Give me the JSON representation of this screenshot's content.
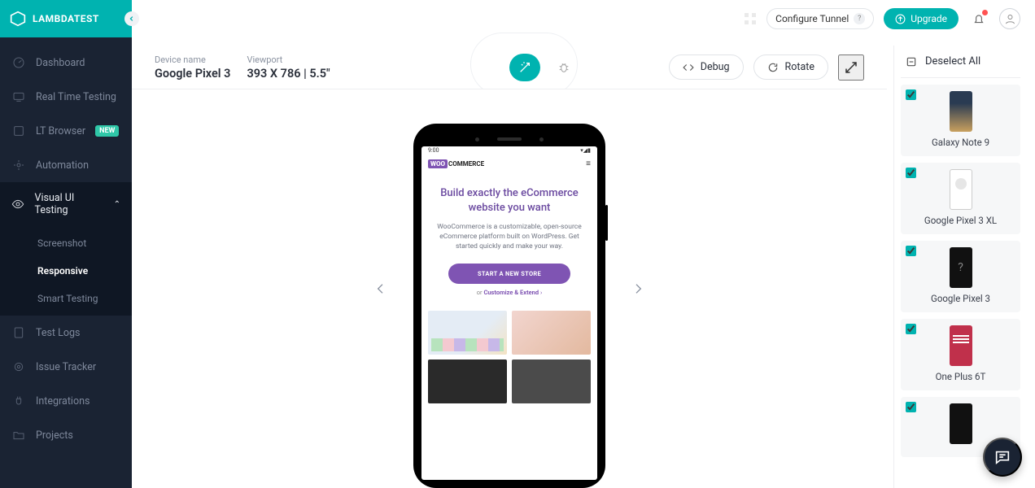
{
  "brand": "LAMBDATEST",
  "topbar": {
    "configure_tunnel": "Configure Tunnel",
    "upgrade": "Upgrade"
  },
  "sidebar": {
    "items": [
      {
        "label": "Dashboard"
      },
      {
        "label": "Real Time Testing"
      },
      {
        "label": "LT Browser",
        "badge": "NEW"
      },
      {
        "label": "Automation"
      },
      {
        "label": "Visual UI Testing"
      },
      {
        "label": "Test Logs"
      },
      {
        "label": "Issue Tracker"
      },
      {
        "label": "Integrations"
      },
      {
        "label": "Projects"
      }
    ],
    "visual_sub": [
      {
        "label": "Screenshot"
      },
      {
        "label": "Responsive"
      },
      {
        "label": "Smart Testing"
      }
    ]
  },
  "subheader": {
    "device_name_label": "Device name",
    "device_name_value": "Google Pixel 3",
    "viewport_label": "Viewport",
    "viewport_value": "393 X 786 | 5.5\"",
    "debug": "Debug",
    "rotate": "Rotate"
  },
  "phone": {
    "status_time": "9:00",
    "woo_prefix": "WOO",
    "woo_suffix": "COMMERCE",
    "hero_title": "Build exactly the eCommerce website you want",
    "hero_sub": "WooCommerce is a customizable, open-source eCommerce platform built on WordPress. Get started quickly and make your way.",
    "cta": "START A NEW STORE",
    "or_prefix": "or",
    "or_link": "Customize & Extend",
    "or_suffix": "›"
  },
  "devices_panel": {
    "deselect": "Deselect All",
    "list": [
      {
        "name": "Galaxy Note 9"
      },
      {
        "name": "Google Pixel 3 XL"
      },
      {
        "name": "Google Pixel 3"
      },
      {
        "name": "One Plus 6T"
      }
    ]
  }
}
